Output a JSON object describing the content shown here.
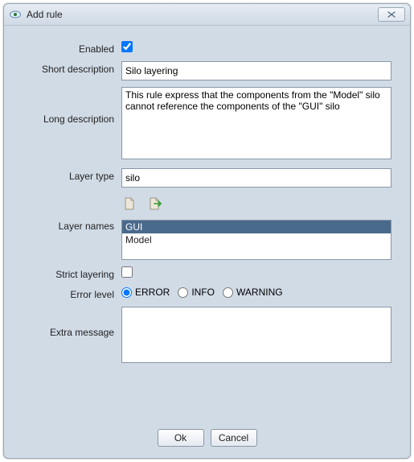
{
  "window": {
    "title": "Add rule"
  },
  "form": {
    "labels": {
      "enabled": "Enabled",
      "short_description": "Short description",
      "long_description": "Long description",
      "layer_type": "Layer type",
      "layer_names": "Layer names",
      "strict_layering": "Strict layering",
      "error_level": "Error level",
      "extra_message": "Extra message"
    },
    "values": {
      "enabled": true,
      "short_description": "Silo layering",
      "long_description": "This rule express that the components from the \"Model\" silo cannot reference the components of the \"GUI\" silo",
      "layer_type": "silo",
      "layer_names": [
        "GUI",
        "Model"
      ],
      "layer_names_selected": "GUI",
      "strict_layering": false,
      "error_level": "ERROR",
      "extra_message": ""
    },
    "error_level_options": [
      "ERROR",
      "INFO",
      "WARNING"
    ]
  },
  "icons": {
    "add_layer": "document-add",
    "edit_layer": "document-export"
  },
  "buttons": {
    "ok": "Ok",
    "cancel": "Cancel"
  }
}
